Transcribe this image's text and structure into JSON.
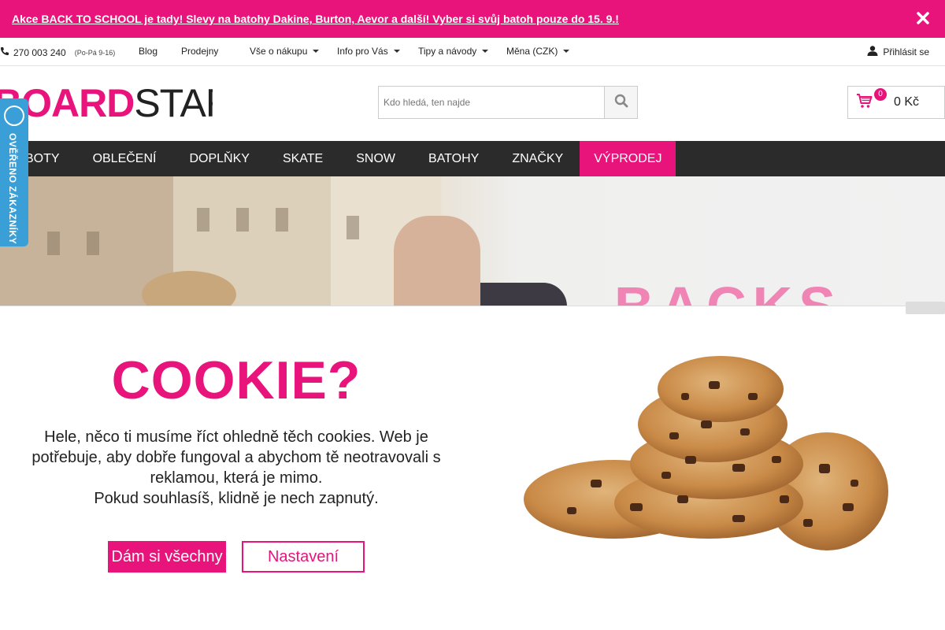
{
  "colors": {
    "brand_pink": "#e8137b",
    "nav_bg": "#2b2b2b",
    "verified_blue": "#3a9fd6"
  },
  "promo": {
    "text": "Akce BACK TO SCHOOL je tady! Slevy na batohy Dakine, Burton, Aevor a další! Vyber si svůj batoh pouze do 15. 9.!",
    "close_icon": "close-icon"
  },
  "topbar": {
    "phone": "270 003 240",
    "hours": "(Po-Pá 9-16)",
    "links": [
      "Blog",
      "Prodejny",
      "Vše o nákupu",
      "Info pro Vás",
      "Tipy a návody",
      "Měna (CZK)"
    ],
    "login": "Přihlásit se"
  },
  "header": {
    "logo_part1": "BOARD",
    "logo_part2": "STAR.CZ",
    "search_placeholder": "Kdo hledá, ten najde",
    "cart_count": "0",
    "cart_total": "0 Kč"
  },
  "verified": {
    "label": "OVĚŘENO ZÁKAZNÍKY"
  },
  "nav": {
    "items": [
      "BOTY",
      "OBLEČENÍ",
      "DOPLŇKY",
      "SKATE",
      "SNOW",
      "BATOHY",
      "ZNAČKY"
    ],
    "sale": "VÝPRODEJ"
  },
  "hero": {
    "word": "BACKS"
  },
  "cookie": {
    "title": "COOKIE?",
    "text_line1": "Hele, něco ti musíme říct ohledně těch cookies. Web je potřebuje, aby dobře fungoval a abychom tě neotravovali s reklamou, která je mimo.",
    "text_line2": "Pokud souhlasíš, klidně je nech zapnutý.",
    "accept_label": "Dám si všechny",
    "settings_label": "Nastavení"
  }
}
